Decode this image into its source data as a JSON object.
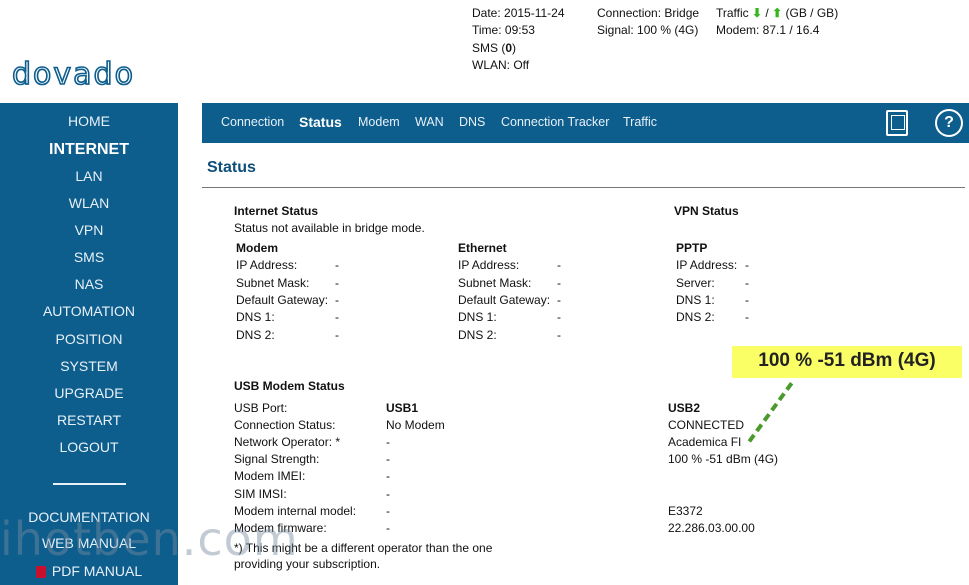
{
  "header": {
    "date": "Date: 2015-11-24",
    "time": "Time: 09:53",
    "sms_prefix": "SMS (",
    "sms_count": "0",
    "sms_suffix": ")",
    "wlan": "WLAN: Off",
    "connection": "Connection: Bridge",
    "signal": "Signal: 100 % (4G)",
    "traffic_label": "Traffic",
    "traffic_sep": "/",
    "traffic_units": "(GB / GB)",
    "modem": "Modem: 87.1 / 16.4",
    "logo_text": "dovado"
  },
  "sidebar": {
    "items": [
      {
        "label": "HOME"
      },
      {
        "label": "INTERNET"
      },
      {
        "label": "LAN"
      },
      {
        "label": "WLAN"
      },
      {
        "label": "VPN"
      },
      {
        "label": "SMS"
      },
      {
        "label": "NAS"
      },
      {
        "label": "AUTOMATION"
      },
      {
        "label": "POSITION"
      },
      {
        "label": "SYSTEM"
      },
      {
        "label": "UPGRADE"
      },
      {
        "label": "RESTART"
      },
      {
        "label": "LOGOUT"
      }
    ],
    "docs": [
      {
        "label": "DOCUMENTATION"
      },
      {
        "label": "WEB MANUAL"
      },
      {
        "label": "PDF MANUAL"
      }
    ]
  },
  "topnav": {
    "tabs": [
      {
        "label": "Connection"
      },
      {
        "label": "Status"
      },
      {
        "label": "Modem"
      },
      {
        "label": "WAN"
      },
      {
        "label": "DNS"
      },
      {
        "label": "Connection Tracker"
      },
      {
        "label": "Traffic"
      }
    ],
    "help_label": "?"
  },
  "page": {
    "title": "Status",
    "internet": {
      "heading": "Internet Status",
      "note": "Status not available in bridge mode.",
      "modem": {
        "heading": "Modem",
        "rows": [
          {
            "label": "IP Address:",
            "value": "-"
          },
          {
            "label": "Subnet Mask:",
            "value": "-"
          },
          {
            "label": "Default Gateway:",
            "value": "-"
          },
          {
            "label": "DNS 1:",
            "value": "-"
          },
          {
            "label": "DNS 2:",
            "value": "-"
          }
        ]
      },
      "ethernet": {
        "heading": "Ethernet",
        "rows": [
          {
            "label": "IP Address:",
            "value": "-"
          },
          {
            "label": "Subnet Mask:",
            "value": "-"
          },
          {
            "label": "Default Gateway:",
            "value": "-"
          },
          {
            "label": "DNS 1:",
            "value": "-"
          },
          {
            "label": "DNS 2:",
            "value": "-"
          }
        ]
      }
    },
    "vpn": {
      "heading": "VPN Status",
      "pptp": {
        "heading": "PPTP",
        "rows": [
          {
            "label": "IP Address:",
            "value": "-"
          },
          {
            "label": "Server:",
            "value": "-"
          },
          {
            "label": "DNS 1:",
            "value": "-"
          },
          {
            "label": "DNS 2:",
            "value": "-"
          }
        ]
      }
    },
    "callout": "100 % -51 dBm (4G)",
    "usb": {
      "heading": "USB Modem Status",
      "labels": [
        "USB Port:",
        "Connection Status:",
        "Network Operator: *",
        "Signal Strength:",
        "Modem IMEI:",
        "SIM IMSI:",
        "Modem internal model:",
        "Modem firmware:"
      ],
      "usb1": [
        "USB1",
        "No Modem",
        "-",
        "-",
        "-",
        "-",
        "-",
        "-"
      ],
      "usb2": [
        "USB2",
        "CONNECTED",
        "Academica FI",
        "100 % -51 dBm (4G)",
        "",
        "",
        "E3372",
        "22.286.03.00.00"
      ],
      "footnote_1": "*) This might be a different operator than the one",
      "footnote_2": "providing your subscription."
    },
    "watermark": "ihotben.com"
  }
}
